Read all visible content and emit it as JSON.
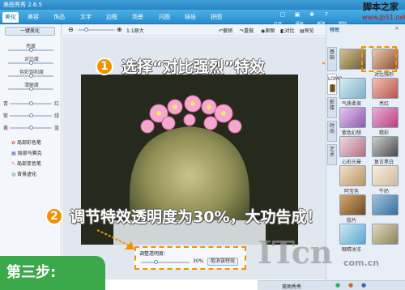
{
  "app": {
    "title": "美图秀秀 2.6.5"
  },
  "main_tabs": [
    "美化",
    "美容",
    "饰品",
    "文字",
    "边框",
    "场景",
    "闪图",
    "娃娃",
    "拼图"
  ],
  "top_actions": [
    "打开",
    "保存",
    "新建",
    "帮助"
  ],
  "watermark": {
    "line1": "脚本之家",
    "line2": "www.Jb51.net"
  },
  "toolbar": {
    "zoom_label": "1:1原大",
    "items": [
      "撤销",
      "重做",
      "原图",
      "对比",
      "预览"
    ]
  },
  "left_panel": {
    "one_click": "一键美化",
    "sliders": [
      "亮度",
      "对比度",
      "色彩饱和度",
      "清晰度"
    ],
    "color_labels": [
      {
        "left": "青",
        "right": "红"
      },
      {
        "left": "紫",
        "right": "绿"
      },
      {
        "left": "黄",
        "right": "蓝"
      }
    ],
    "tools": [
      "局部彩色笔",
      "局部马赛克",
      "局部变色笔",
      "背景虚化"
    ]
  },
  "right_panel": {
    "title": "特效",
    "vertical_tabs": [
      "基础",
      "LOMO",
      "影楼",
      "时尚",
      "艺术"
    ],
    "effects": [
      "对比强烈",
      "",
      "气质柔美",
      "亮红",
      "紫色幻想",
      "精彩",
      "心形光晕",
      "复古黑白",
      "阿宝色",
      "牛奶",
      "胶片",
      "",
      "眼睛冰冻",
      ""
    ]
  },
  "callouts": {
    "one_number": "1",
    "one_text": "选择“对比强烈”特效",
    "two_number": "2",
    "two_text": "调节特效透明度为30%，大功告成！"
  },
  "opacity_control": {
    "label": "调整透明度：",
    "value": "30%",
    "button": "取消该特效"
  },
  "step": "第三步:",
  "brand": {
    "logo": "ITcn",
    "domain": "com.cn"
  },
  "status": [
    "美图秀秀",
    "",
    "",
    ""
  ],
  "colors": {
    "accent": "#f29100",
    "title_bar": "#2b84c4",
    "step_green": "#3ba84a"
  }
}
